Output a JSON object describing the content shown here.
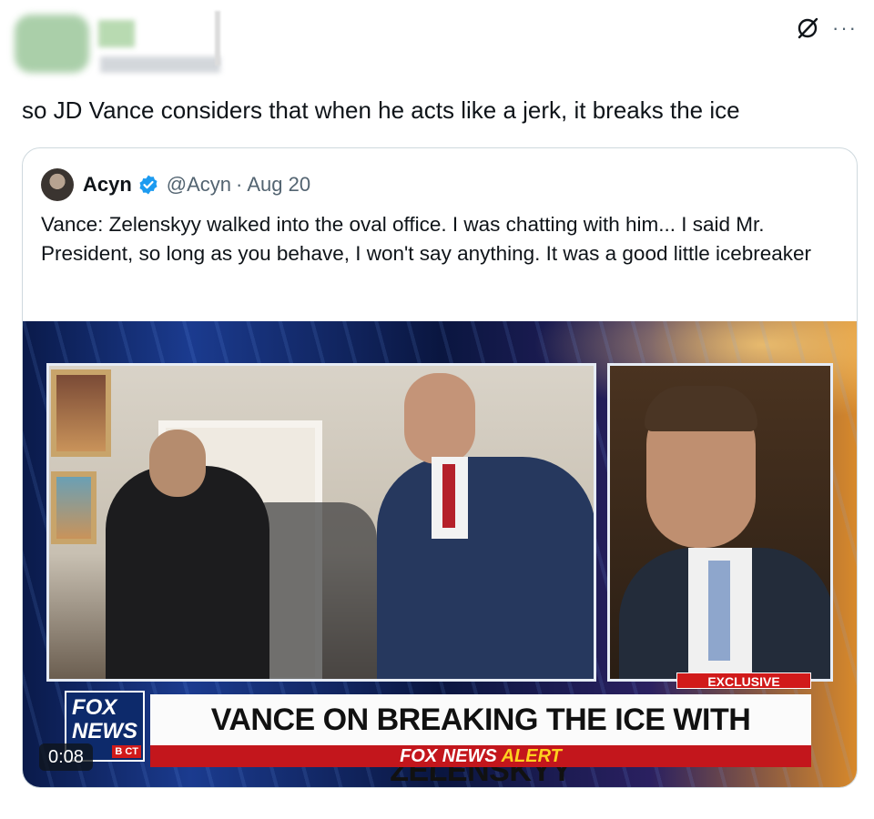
{
  "post": {
    "text": "so JD Vance considers that when he acts like a jerk, it breaks the ice",
    "more_label": "···"
  },
  "quote": {
    "author_name": "Acyn",
    "handle": "@Acyn",
    "separator": "·",
    "date": "Aug 20",
    "text": "Vance: Zelenskyy walked into the oval office. I was chatting with him... I said Mr. President, so long as you behave, I won't say anything. It was a good little icebreaker"
  },
  "video": {
    "exclusive_label": "EXCLUSIVE",
    "network_logo_line1": "FOX",
    "network_logo_line2": "NEWS",
    "network_logo_suffix": "B CT",
    "headline": "VANCE ON BREAKING THE ICE WITH ZELENSKYY",
    "alert_prefix": "FOX NEWS",
    "alert_word": "ALERT",
    "timestamp": "0:08"
  },
  "colors": {
    "verified_blue": "#1d9bf0",
    "fox_red": "#c3161c",
    "alert_yellow": "#ffd21f"
  }
}
